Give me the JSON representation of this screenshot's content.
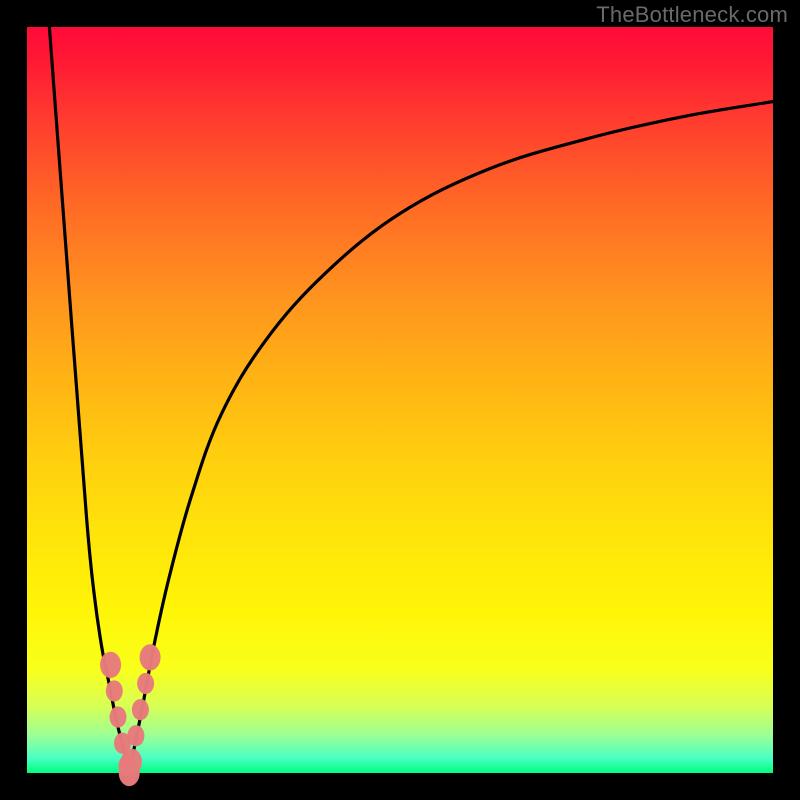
{
  "watermark": "TheBottleneck.com",
  "colors": {
    "background": "#000000",
    "curve": "#000000",
    "marker": "#e77b7b",
    "gradient_top": "#ff0a3a",
    "gradient_bottom": "#00ff80"
  },
  "chart_data": {
    "type": "line",
    "title": "",
    "xlabel": "",
    "ylabel": "",
    "xlim": [
      0,
      100
    ],
    "ylim": [
      0,
      100
    ],
    "series": [
      {
        "name": "bottleneck-curve-left",
        "x": [
          3.0,
          6.0,
          8.0,
          9.0,
          10.0,
          11.0,
          12.0,
          13.0,
          13.7
        ],
        "values": [
          100,
          60,
          34,
          24,
          17,
          12,
          7,
          3,
          0
        ]
      },
      {
        "name": "bottleneck-curve-right",
        "x": [
          13.7,
          14.5,
          15.5,
          17,
          19,
          22,
          26,
          32,
          40,
          50,
          62,
          75,
          88,
          100
        ],
        "values": [
          0,
          4,
          9,
          17,
          26,
          37,
          48,
          58,
          67,
          75,
          81,
          85,
          88,
          90
        ]
      }
    ],
    "markers": [
      {
        "x": 11.2,
        "y": 14.5
      },
      {
        "x": 11.7,
        "y": 11.0
      },
      {
        "x": 12.2,
        "y": 7.5
      },
      {
        "x": 12.8,
        "y": 4.0
      },
      {
        "x": 13.4,
        "y": 1.0
      },
      {
        "x": 13.7,
        "y": 0.0
      },
      {
        "x": 14.0,
        "y": 1.5
      },
      {
        "x": 14.6,
        "y": 5.0
      },
      {
        "x": 15.2,
        "y": 8.5
      },
      {
        "x": 15.9,
        "y": 12.0
      },
      {
        "x": 16.5,
        "y": 15.5
      }
    ]
  }
}
